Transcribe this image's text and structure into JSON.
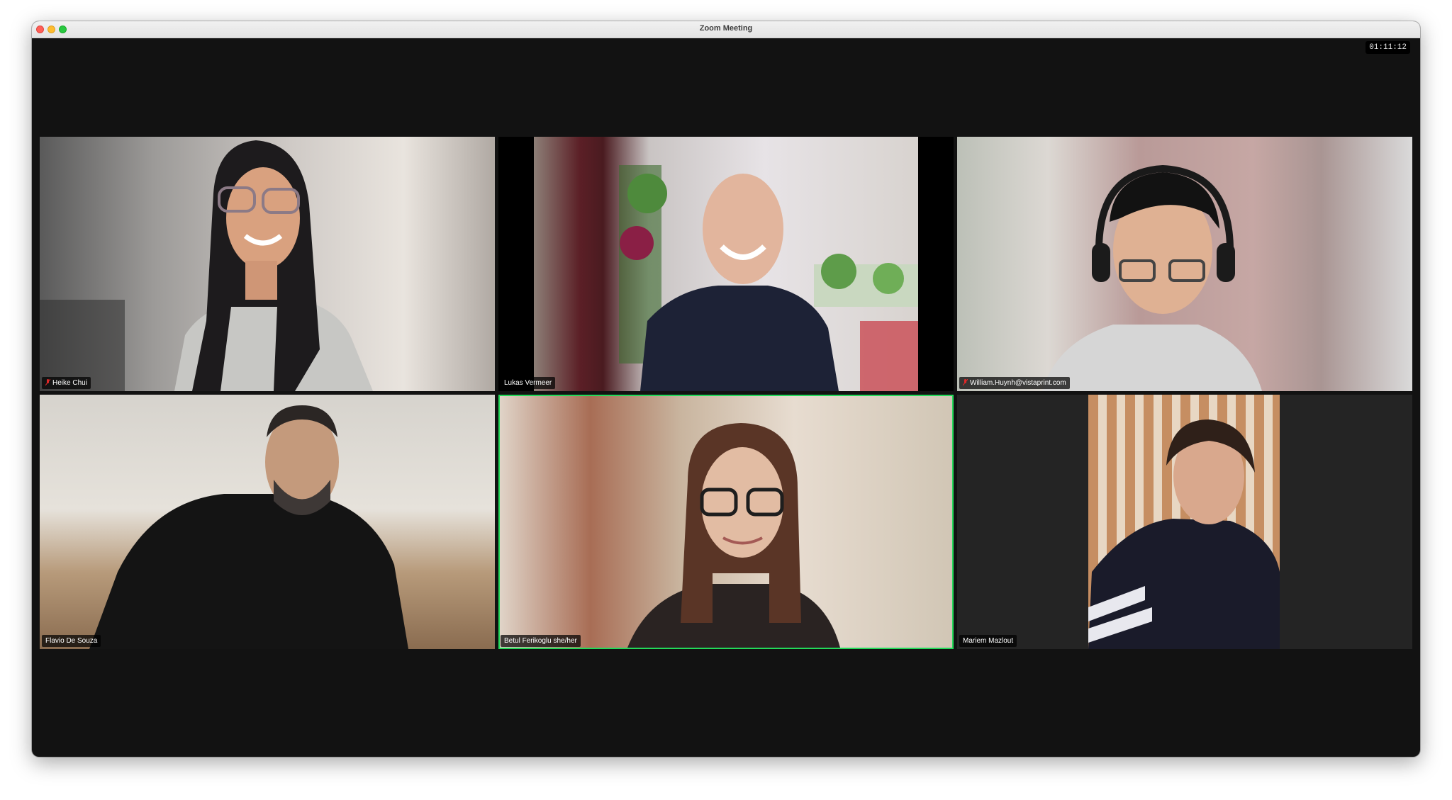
{
  "window": {
    "title": "Zoom Meeting",
    "timer": "01:11:12"
  },
  "participants": [
    {
      "name": "Heike Chui",
      "muted": true,
      "active": false
    },
    {
      "name": "Lukas Vermeer",
      "muted": false,
      "active": false
    },
    {
      "name": "William.Huynh@vistaprint.com",
      "muted": true,
      "active": false
    },
    {
      "name": "Flavio De Souza",
      "muted": false,
      "active": false
    },
    {
      "name": "Betul Ferikoglu she/her",
      "muted": false,
      "active": true
    },
    {
      "name": "Mariem Mazlout",
      "muted": false,
      "active": false
    }
  ],
  "colors": {
    "active_speaker_border": "#23d959",
    "muted_icon": "#e02828"
  }
}
